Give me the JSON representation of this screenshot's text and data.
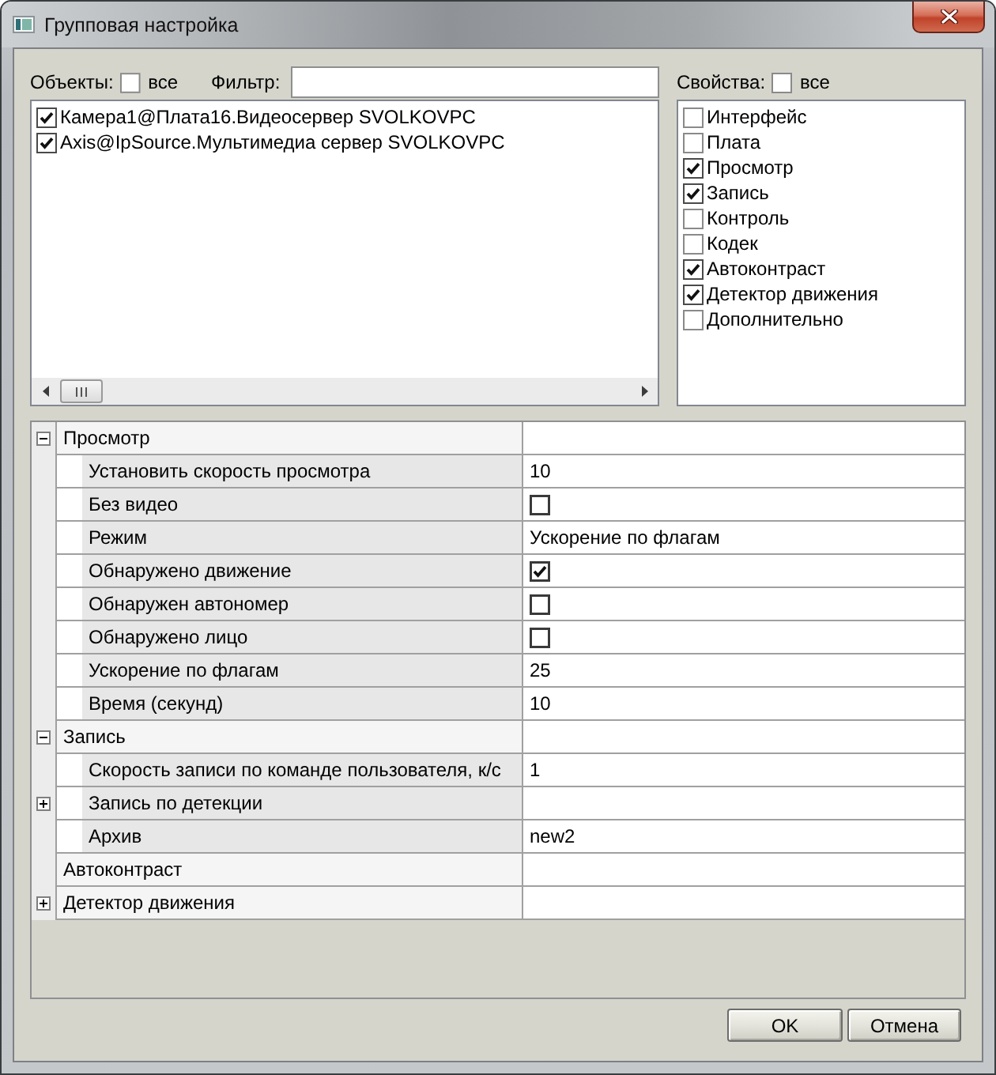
{
  "window": {
    "title": "Групповая настройка"
  },
  "objects": {
    "label": "Объекты:",
    "all_label": "все",
    "all_checked": false,
    "filter_label": "Фильтр:",
    "items": [
      {
        "label": "Камера1@Плата16.Видеосервер SVOLKOVPC",
        "checked": true
      },
      {
        "label": "Axis@IpSource.Мультимедиа сервер SVOLKOVPC",
        "checked": true
      }
    ]
  },
  "properties": {
    "label": "Свойства:",
    "all_label": "все",
    "all_checked": false,
    "items": [
      {
        "label": "Интерфейс",
        "checked": false
      },
      {
        "label": "Плата",
        "checked": false
      },
      {
        "label": "Просмотр",
        "checked": true
      },
      {
        "label": "Запись",
        "checked": true
      },
      {
        "label": "Контроль",
        "checked": false
      },
      {
        "label": "Кодек",
        "checked": false
      },
      {
        "label": "Автоконтраст",
        "checked": true
      },
      {
        "label": "Детектор движения",
        "checked": true
      },
      {
        "label": "Дополнительно",
        "checked": false
      }
    ]
  },
  "grid": {
    "rows": [
      {
        "kind": "group",
        "name": "Просмотр",
        "expanded": true,
        "children": [
          {
            "kind": "text",
            "name": "Установить скорость просмотра",
            "value": "10"
          },
          {
            "kind": "checkbox",
            "name": "Без видео",
            "checked": false
          },
          {
            "kind": "text",
            "name": "Режим",
            "value": "Ускорение по флагам"
          },
          {
            "kind": "checkbox",
            "name": "Обнаружено движение",
            "checked": true
          },
          {
            "kind": "checkbox",
            "name": "Обнаружен автономер",
            "checked": false
          },
          {
            "kind": "checkbox",
            "name": "Обнаружено лицо",
            "checked": false
          },
          {
            "kind": "text",
            "name": "Ускорение по флагам",
            "value": "25"
          },
          {
            "kind": "text",
            "name": "Время (секунд)",
            "value": "10"
          }
        ]
      },
      {
        "kind": "group",
        "name": "Запись",
        "expanded": true,
        "children": [
          {
            "kind": "text",
            "name": "Скорость записи по команде пользователя, к/с",
            "value": "1"
          },
          {
            "kind": "group",
            "name": "Запись по детекции",
            "expanded": false
          },
          {
            "kind": "text",
            "name": "Архив",
            "value": "new2"
          }
        ]
      },
      {
        "kind": "label",
        "name": "Автоконтраст"
      },
      {
        "kind": "group",
        "name": "Детектор движения",
        "expanded": false
      }
    ]
  },
  "buttons": [
    {
      "label": "OK"
    },
    {
      "label": "Отмена"
    }
  ]
}
